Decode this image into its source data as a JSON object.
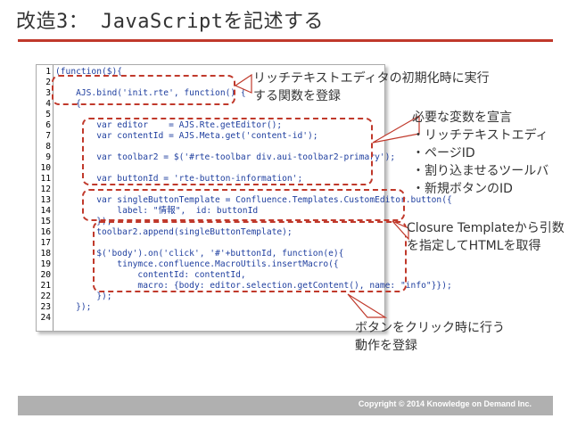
{
  "slide": {
    "title": "改造3： JavaScriptを記述する",
    "footer": "Copyright © 2014 Knowledge on Demand Inc."
  },
  "code_lines": [
    {
      "n": "1",
      "code": "(function($){"
    },
    {
      "n": "2",
      "code": ""
    },
    {
      "n": "3",
      "code": "    AJS.bind('init.rte', function() {"
    },
    {
      "n": "4",
      "code": "    {"
    },
    {
      "n": "5",
      "code": ""
    },
    {
      "n": "6",
      "code": "        var editor    = AJS.Rte.getEditor();"
    },
    {
      "n": "7",
      "code": "        var contentId = AJS.Meta.get('content-id');"
    },
    {
      "n": "8",
      "code": ""
    },
    {
      "n": "9",
      "code": "        var toolbar2 = $('#rte-toolbar div.aui-toolbar2-primary');"
    },
    {
      "n": "10",
      "code": ""
    },
    {
      "n": "11",
      "code": "        var buttonId = 'rte-button-information';"
    },
    {
      "n": "12",
      "code": ""
    },
    {
      "n": "13",
      "code": "        var singleButtonTemplate = Confluence.Templates.CustomEditor.button({"
    },
    {
      "n": "14",
      "code": "            label: \"情報\",  id: buttonId"
    },
    {
      "n": "15",
      "code": "        });"
    },
    {
      "n": "16",
      "code": "        toolbar2.append(singleButtonTemplate);"
    },
    {
      "n": "17",
      "code": ""
    },
    {
      "n": "18",
      "code": "        $('body').on('click', '#'+buttonId, function(e){"
    },
    {
      "n": "19",
      "code": "            tinymce.confluence.MacroUtils.insertMacro({"
    },
    {
      "n": "20",
      "code": "                contentId: contentId,"
    },
    {
      "n": "21",
      "code": "                macro: {body: editor.selection.getContent(), name: \"info\"}});"
    },
    {
      "n": "22",
      "code": "        });"
    },
    {
      "n": "23",
      "code": "    });"
    },
    {
      "n": "24",
      "code": ""
    }
  ],
  "callouts": {
    "init": {
      "line1": "リッチテキストエディタの初期化時に実行",
      "line2": "する関数を登録"
    },
    "vars": {
      "line1": "必要な変数を宣言",
      "line2": "・リッチテキストエディ",
      "line3": "・ページID",
      "line4": "・割り込ませるツールバ",
      "line5": "・新規ボタンのID"
    },
    "closure": {
      "line1": "Closure Templateから引数",
      "line2": "を指定してHTMLを取得"
    },
    "click": {
      "line1": "ボタンをクリック時に行う",
      "line2": "動作を登録"
    }
  },
  "colors": {
    "accent": "#c0392b",
    "code_text": "#1f3f9f",
    "footer_bg": "#b0b0b0"
  }
}
